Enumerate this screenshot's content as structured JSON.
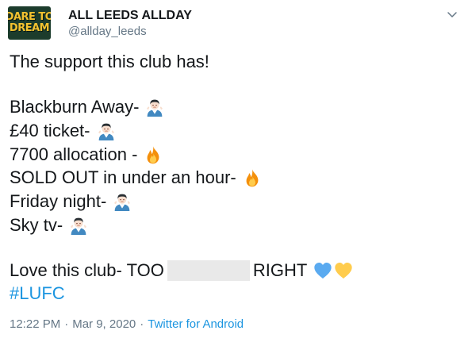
{
  "author": {
    "avatar_text_1": "DARE TO",
    "avatar_text_2": "DREAM",
    "display_name": "ALL LEEDS ALLDAY",
    "handle": "@allday_leeds"
  },
  "tweet": {
    "intro": "The support this club has!",
    "lines": [
      {
        "text": "Blackburn Away-",
        "emoji": "man-shrugging-face"
      },
      {
        "text": "£40 ticket-",
        "emoji": "man-shrugging-face"
      },
      {
        "text": "7700 allocation -",
        "emoji": "fire"
      },
      {
        "text": "SOLD OUT in under an hour-",
        "emoji": "fire"
      },
      {
        "text": "Friday night-",
        "emoji": "man-shrugging-face"
      },
      {
        "text": "Sky tv-",
        "emoji": "man-shrugging-face"
      }
    ],
    "closing_before": "Love this club- TOO",
    "closing_after": "RIGHT",
    "closing_emojis": [
      "blue-heart",
      "yellow-heart"
    ],
    "hashtag": "#LUFC"
  },
  "meta": {
    "time": "12:22 PM",
    "date": "Mar 9, 2020",
    "separator": "·",
    "source": "Twitter for Android"
  },
  "colors": {
    "link": "#1b95e0",
    "secondary_text": "#657786",
    "primary_text": "#14171a",
    "blue_heart": "#5aaaf0",
    "yellow_heart": "#ffcc4d",
    "fire": "#f4900c"
  }
}
